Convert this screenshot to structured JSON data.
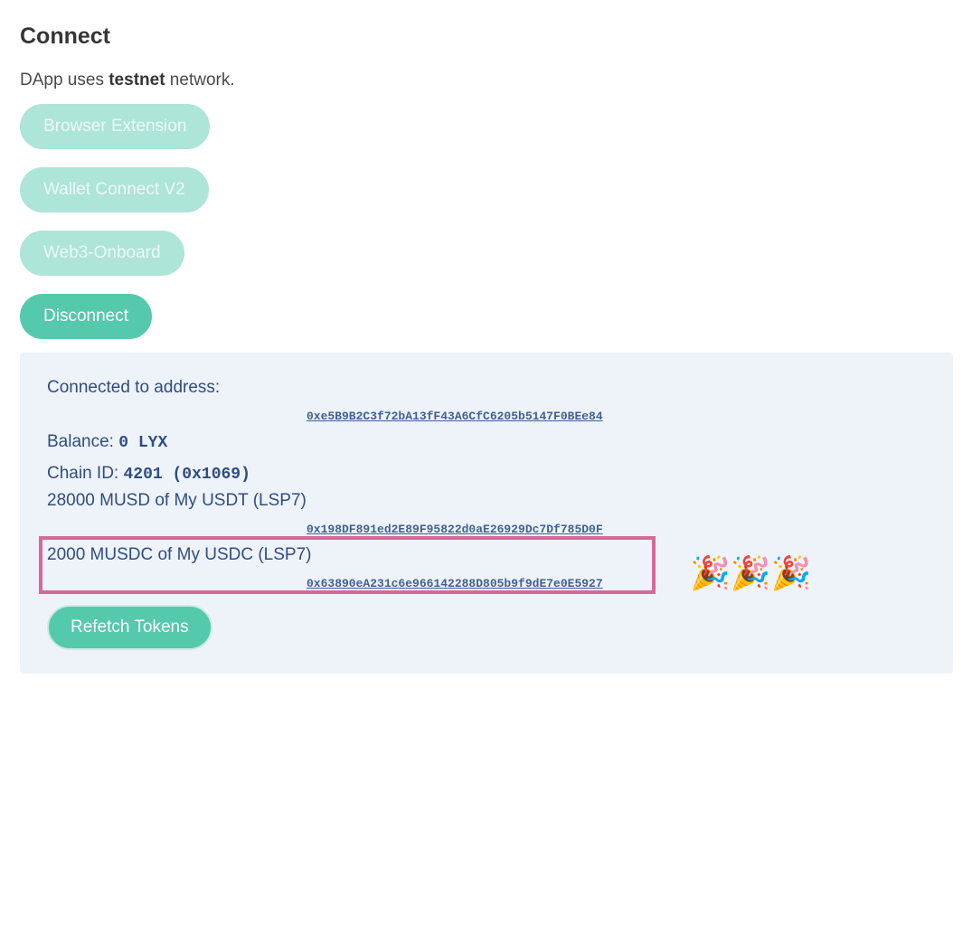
{
  "header": {
    "title": "Connect",
    "network_prefix": "DApp uses ",
    "network_name": "testnet",
    "network_suffix": " network."
  },
  "buttons": {
    "browser_extension": "Browser Extension",
    "wallet_connect": "Wallet Connect V2",
    "web3_onboard": "Web3-Onboard",
    "disconnect": "Disconnect"
  },
  "account": {
    "connected_label": "Connected to address:",
    "address": "0xe5B9B2C3f72bA13fF43A6CfC6205b5147F0BEe84",
    "balance_label": "Balance: ",
    "balance_value": "0 LYX",
    "chain_label": "Chain ID: ",
    "chain_value": "4201 (0x1069)"
  },
  "tokens": [
    {
      "label": "28000 MUSD of My USDT (LSP7)",
      "address": "0x198DF891ed2E89F95822d0aE26929Dc7Df785D0F"
    },
    {
      "label": "2000 MUSDC of My USDC (LSP7)",
      "address": "0x63890eA231c6e966142288D805b9f9dE7e0E5927",
      "highlighted": true
    }
  ],
  "celebration": {
    "icon": "party-popper-icon",
    "glyphs": "🎉🎉🎉"
  },
  "refetch_label": "Refetch Tokens",
  "colors": {
    "accent": "#55c9ac",
    "accent_disabled": "#ade5d8",
    "panel_bg": "#eef3fa",
    "panel_text": "#2f4d80",
    "highlight_border": "#d96797"
  }
}
